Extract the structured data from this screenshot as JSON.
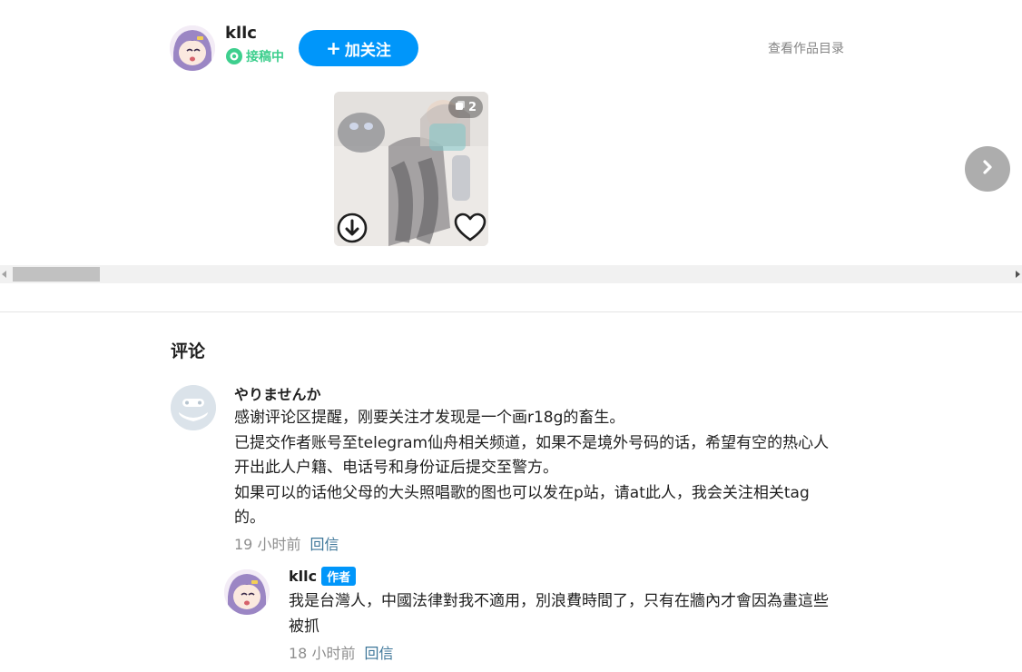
{
  "author": {
    "name": "kllc",
    "status_label": "接稿中",
    "follow_label": "加关注",
    "follow_icon": "plus-icon",
    "works_link": "查看作品目录"
  },
  "artwork": {
    "page_count": "2",
    "download_icon": "download-icon",
    "like_icon": "heart-icon"
  },
  "comments": {
    "title": "评论",
    "items": [
      {
        "user": "やりませんか",
        "lines": [
          "感谢评论区提醒，刚要关注才发现是一个画r18g的畜生。",
          "已提交作者账号至telegram仙舟相关频道，如果不是境外号码的话，希望有空的热心人",
          "开出此人户籍、电话号和身份证后提交至警方。",
          "如果可以的话他父母的大头照唱歌的图也可以发在p站，请at此人，我会关注相关tag",
          "的。"
        ],
        "time": "19 小时前",
        "reply_label": "回信"
      },
      {
        "user": "kllc",
        "badge": "作者",
        "lines": [
          "我是台灣人，中國法律對我不適用，別浪費時間了，只有在牆內才會因為畫這些",
          "被抓"
        ],
        "time": "18 小时前",
        "reply_label": "回信"
      }
    ]
  },
  "colors": {
    "accent": "#0096fa",
    "status_green": "#3ecf8e",
    "reply_link": "#3d7699",
    "muted": "#8f8f8f"
  }
}
